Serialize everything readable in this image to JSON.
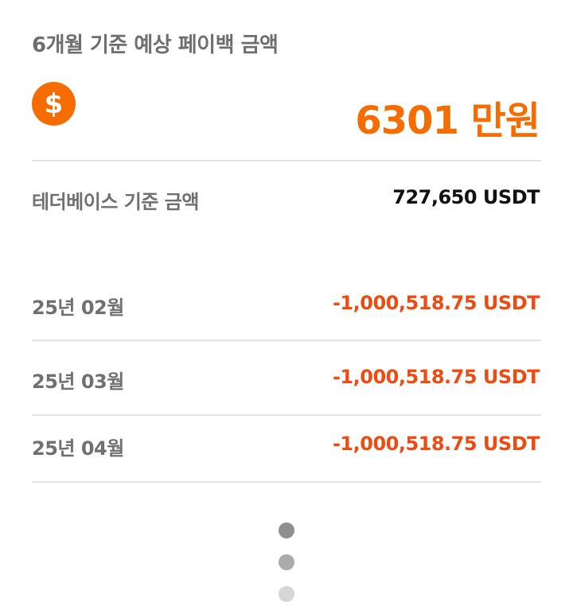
{
  "header": {
    "title": "6개월 기준 예상 페이백 금액",
    "icon": "dollar-icon",
    "icon_glyph": "$",
    "amount": "6301 만원"
  },
  "base": {
    "label": "테더베이스 기준 금액",
    "value": "727,650 USDT"
  },
  "rows": [
    {
      "label": "25년 02월",
      "value": "-1,000,518.75 USDT"
    },
    {
      "label": "25년 03월",
      "value": "-1,000,518.75 USDT"
    },
    {
      "label": "25년 04월",
      "value": "-1,000,518.75 USDT"
    }
  ],
  "pager": {
    "dots": 3,
    "active_index": 0
  },
  "colors": {
    "accent": "#f56c00",
    "negative": "#ee4b12",
    "label": "#707070",
    "divider": "#e3e3e3",
    "dot_active": "#8f8f8f",
    "dot_mid": "#ababab",
    "dot_inactive": "#d6d6d6"
  }
}
